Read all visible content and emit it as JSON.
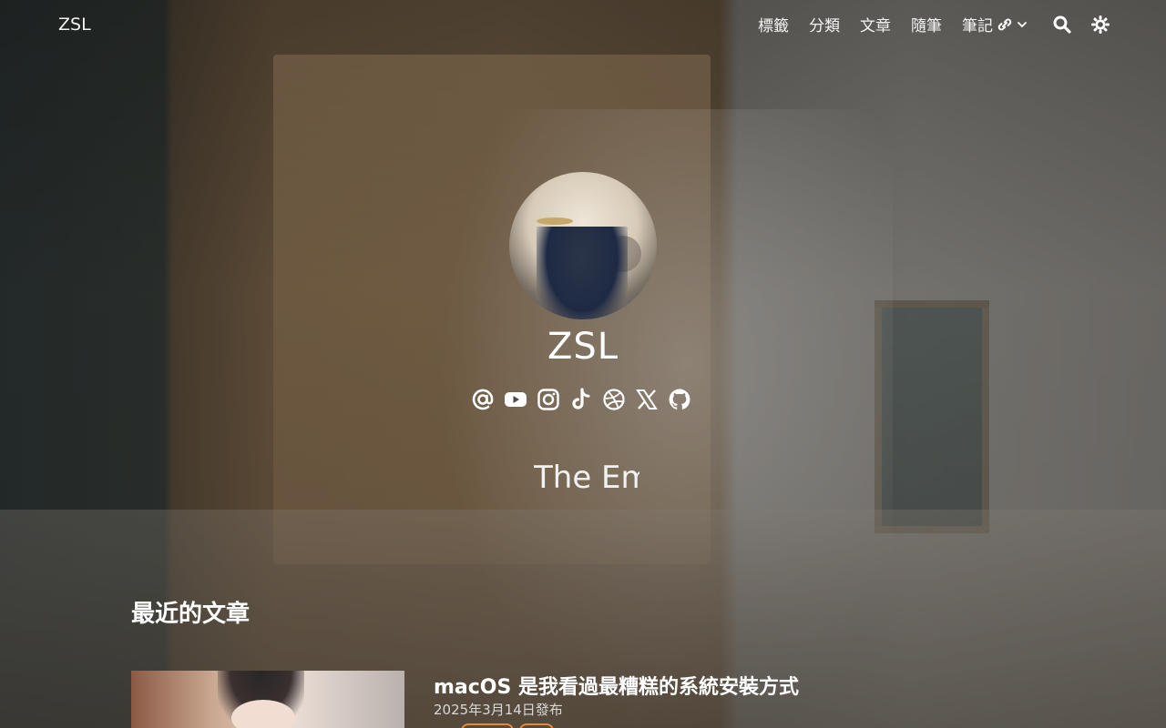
{
  "header": {
    "brand": "ZSL",
    "nav": [
      {
        "label": "標籤"
      },
      {
        "label": "分類"
      },
      {
        "label": "文章"
      },
      {
        "label": "隨筆"
      },
      {
        "label": "筆記"
      }
    ],
    "icons": [
      "search-icon",
      "theme-toggle-icon"
    ]
  },
  "profile": {
    "title": "ZSL",
    "tagline": "The Em",
    "socials": [
      "email-icon",
      "youtube-icon",
      "instagram-icon",
      "tiktok-icon",
      "dribbble-icon",
      "x-icon",
      "github-icon"
    ]
  },
  "recent": {
    "heading": "最近的文章",
    "posts": [
      {
        "title": "macOS 是我看過最糟糕的系統安裝方式",
        "date": "2025年3月14日發布"
      }
    ]
  },
  "colors": {
    "accent": "#e08a3c",
    "text": "#ffffff"
  }
}
